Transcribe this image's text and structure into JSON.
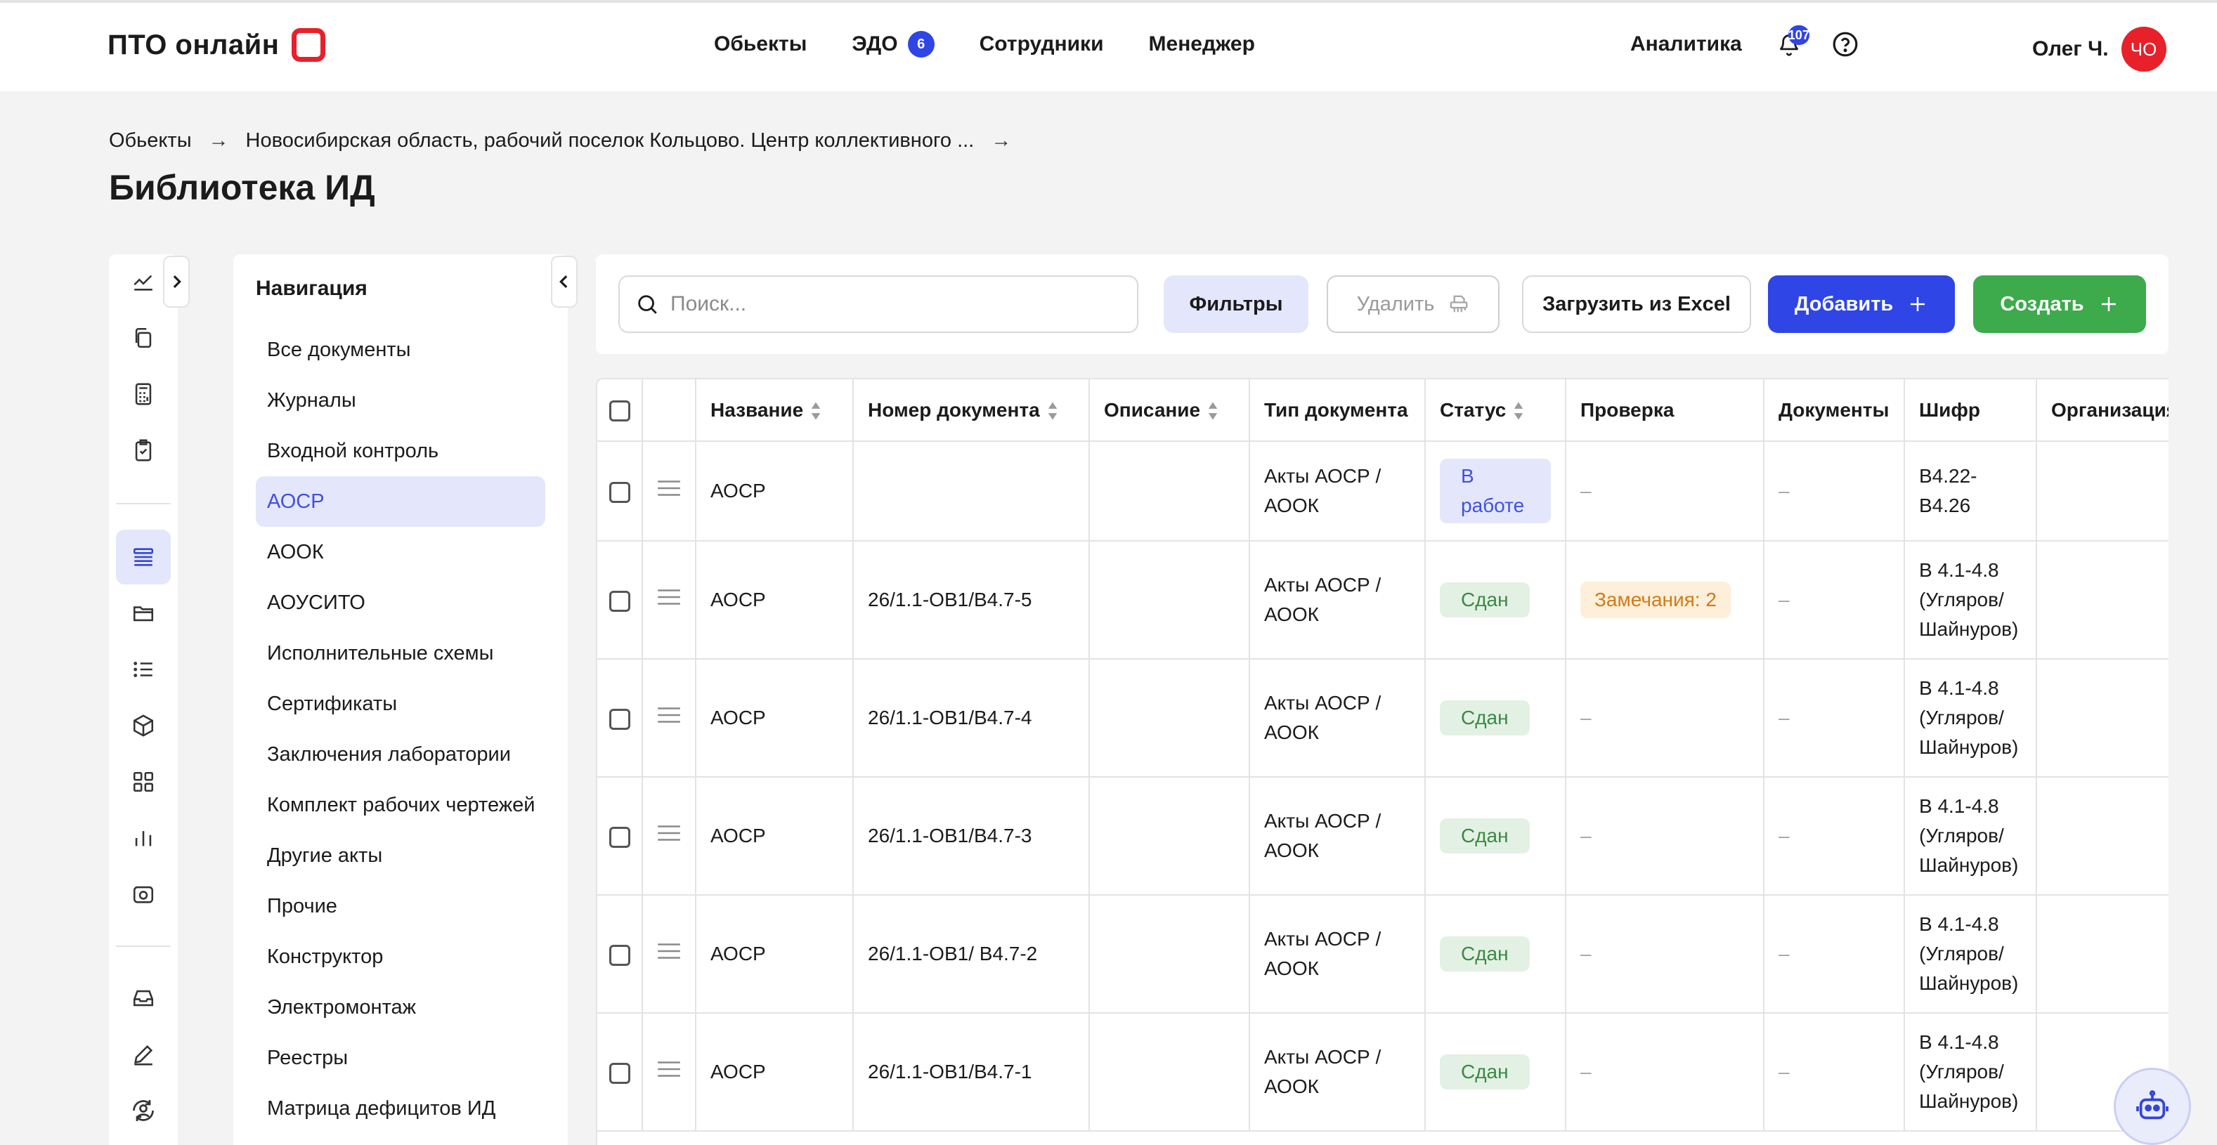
{
  "header": {
    "logo_text": "ПТО онлайн",
    "nav": [
      {
        "label": "Обьекты"
      },
      {
        "label": "ЭДО",
        "badge": "6"
      },
      {
        "label": "Сотрудники"
      },
      {
        "label": "Менеджер"
      }
    ],
    "analytics_label": "Аналитика",
    "notifications_count": "107",
    "user_name": "Олег Ч.",
    "user_initials": "ЧО",
    "accent_color": "#2f45e6",
    "brand_color": "#e8202a"
  },
  "breadcrumb": {
    "items": [
      "Обьекты",
      "Новосибирская область, рабочий поселок Кольцово. Центр коллективного ..."
    ]
  },
  "page_title": "Библиотека ИД",
  "icon_rail": {
    "items": [
      "chart-line-icon",
      "copy-icon",
      "calculator-icon",
      "clipboard-check-icon",
      "list-view-icon",
      "folder-icon",
      "list-icon",
      "cube-icon",
      "grid-icon",
      "bar-chart-icon",
      "camera-icon",
      "inbox-icon",
      "pencil-icon",
      "user-sync-icon"
    ],
    "active_index": 4
  },
  "navigation": {
    "heading": "Навигация",
    "items": [
      "Все документы",
      "Журналы",
      "Входной контроль",
      "АОСР",
      "АООК",
      "АОУСИТО",
      "Исполнительные схемы",
      "Сертификаты",
      "Заключения лаборатории",
      "Комплект рабочих чертежей",
      "Другие акты",
      "Прочие",
      "Конструктор",
      "Электромонтаж",
      "Реестры",
      "Матрица дефицитов ИД"
    ],
    "active": "АОСР"
  },
  "toolbar": {
    "search_placeholder": "Поиск...",
    "filters_label": "Фильтры",
    "delete_label": "Удалить",
    "excel_label": "Загрузить из Excel",
    "add_label": "Добавить",
    "create_label": "Создать",
    "create_color": "#3daa4c"
  },
  "table": {
    "columns": [
      "Название",
      "Номер документа",
      "Описание",
      "Тип документа",
      "Статус",
      "Проверка",
      "Документы",
      "Шифр",
      "Организация"
    ],
    "rows": [
      {
        "name": "АОСР",
        "number": "",
        "description": "",
        "type": "Акты АОСР / АООК",
        "status": "В работе",
        "status_kind": "work",
        "check": "–",
        "docs": "–",
        "cipher": "В4.22-В4.26"
      },
      {
        "name": "АОСР",
        "number": "26/1.1-ОВ1/В4.7-5",
        "description": "",
        "type": "Акты АОСР / АООК",
        "status": "Сдан",
        "status_kind": "done",
        "check": "Замечания: 2",
        "docs": "–",
        "cipher": "В 4.1-4.8 (Угляров/Шайнуров)"
      },
      {
        "name": "АОСР",
        "number": "26/1.1-ОВ1/В4.7-4",
        "description": "",
        "type": "Акты АОСР / АООК",
        "status": "Сдан",
        "status_kind": "done",
        "check": "–",
        "docs": "–",
        "cipher": "В 4.1-4.8 (Угляров/Шайнуров)"
      },
      {
        "name": "АОСР",
        "number": "26/1.1-ОВ1/В4.7-3",
        "description": "",
        "type": "Акты АОСР / АООК",
        "status": "Сдан",
        "status_kind": "done",
        "check": "–",
        "docs": "–",
        "cipher": "В 4.1-4.8 (Угляров/Шайнуров)"
      },
      {
        "name": "АОСР",
        "number": "26/1.1-ОВ1/ В4.7-2",
        "description": "",
        "type": "Акты АОСР / АООК",
        "status": "Сдан",
        "status_kind": "done",
        "check": "–",
        "docs": "–",
        "cipher": "В 4.1-4.8 (Угляров/Шайнуров)"
      },
      {
        "name": "АОСР",
        "number": "26/1.1-ОВ1/В4.7-1",
        "description": "",
        "type": "Акты АОСР / АООК",
        "status": "Сдан",
        "status_kind": "done",
        "check": "–",
        "docs": "–",
        "cipher": "В 4.1-4.8 (Угляров/Шайнуров)"
      }
    ]
  }
}
